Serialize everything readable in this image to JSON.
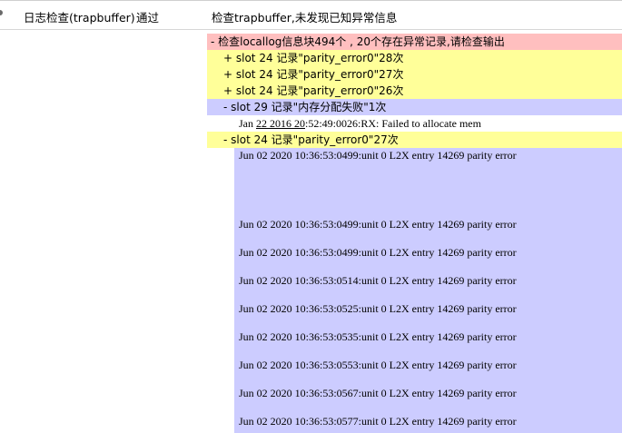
{
  "header": {
    "name": "日志检查(trapbuffer)",
    "status": "通过",
    "detail": "检查trapbuffer,未发现已知异常信息"
  },
  "detail_lines": {
    "summary": "- 检查locallog信息块494个 , 20个存在异常记录,请检查输出",
    "slot_a": "+ slot 24 记录\"parity_error0\"28次",
    "slot_b": "+ slot 24 记录\"parity_error0\"27次",
    "slot_c": "+ slot 24 记录\"parity_error0\"26次",
    "slot_d": "- slot 29 记录\"内存分配失败\"1次",
    "jan_prefix": "Jan ",
    "jan_u1": "22 2016 20",
    "jan_rest": ":52:49:0026:RX: Failed to allocate mem",
    "slot_e": "- slot 24 记录\"parity_error0\"27次"
  },
  "logs": [
    "Jun 02 2020 10:36:53:0499:unit 0 L2X entry 14269 parity error",
    "Jun 02 2020 10:36:53:0499:unit 0 L2X entry 14269 parity error",
    "Jun 02 2020 10:36:53:0499:unit 0 L2X entry 14269 parity error",
    "Jun 02 2020 10:36:53:0514:unit 0 L2X entry 14269 parity error",
    "Jun 02 2020 10:36:53:0525:unit 0 L2X entry 14269 parity error",
    "Jun 02 2020 10:36:53:0535:unit 0 L2X entry 14269 parity error",
    "Jun 02 2020 10:36:53:0553:unit 0 L2X entry 14269 parity error",
    "Jun 02 2020 10:36:53:0567:unit 0 L2X entry 14269 parity error",
    "Jun 02 2020 10:36:53:0577:unit 0 L2X entry 14269 parity error"
  ],
  "colors": {
    "error_header": "#ffbfbf",
    "warning": "#ffff99",
    "detail_block": "#ccccff"
  }
}
